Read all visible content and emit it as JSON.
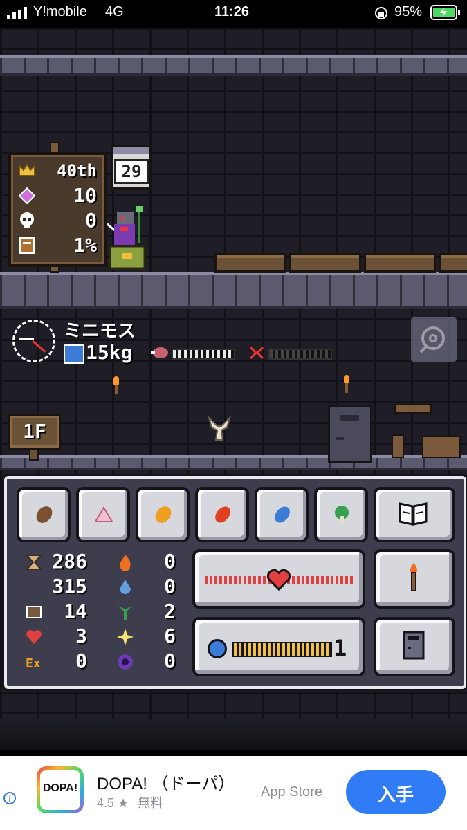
{
  "status_bar": {
    "carrier": "Y!mobile",
    "network": "4G",
    "time": "11:26",
    "battery": "95%"
  },
  "hud": {
    "rank": "40th",
    "gems": "10",
    "skulls": "0",
    "book_percent": "1%",
    "calendar_day": "29"
  },
  "monster": {
    "name": "ミニモス",
    "weight": "15kg",
    "meat_level": 0.7,
    "anger_level": 0.0
  },
  "floor": {
    "label": "1F"
  },
  "stats_left": [
    {
      "icon": "hourglass-icon",
      "value": "286"
    },
    {
      "icon": "hourglass-max",
      "value": "315"
    },
    {
      "icon": "claw-icon",
      "value": "14"
    },
    {
      "icon": "heart-icon",
      "value": "3"
    },
    {
      "icon": "exp-icon",
      "value": "0"
    }
  ],
  "stats_right": [
    {
      "icon": "fire-icon",
      "value": "0"
    },
    {
      "icon": "water-icon",
      "value": "0"
    },
    {
      "icon": "plant-icon",
      "value": "2"
    },
    {
      "icon": "light-icon",
      "value": "6"
    },
    {
      "icon": "dark-icon",
      "value": "0"
    }
  ],
  "exp": {
    "level": "1",
    "progress": 1.0
  },
  "ad": {
    "logo_text": "DOPA!",
    "title": "DOPA! （ドーパ）",
    "rating": "4.5 ★",
    "price": "無料",
    "store": "App Store",
    "button": "入手",
    "info": "i"
  }
}
